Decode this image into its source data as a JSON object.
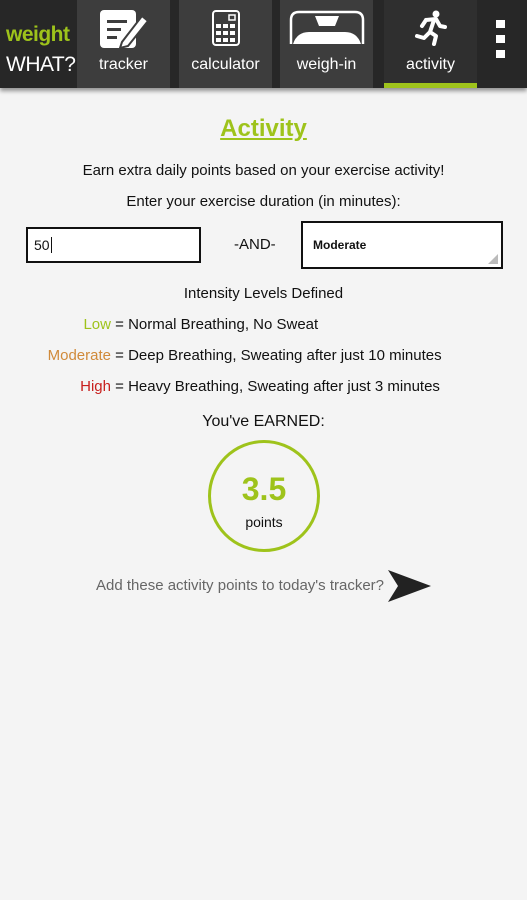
{
  "app": {
    "logo_top": "weight",
    "logo_bottom": "WHAT?"
  },
  "tabs": [
    {
      "label": "tracker",
      "icon": "tracker-icon"
    },
    {
      "label": "calculator",
      "icon": "calculator-icon"
    },
    {
      "label": "weigh-in",
      "icon": "scale-icon"
    },
    {
      "label": "activity",
      "icon": "running-icon",
      "active": true
    }
  ],
  "page": {
    "title": "Activity",
    "subtitle": "Earn extra daily points based on your exercise activity!",
    "prompt": "Enter your exercise duration (in minutes):",
    "duration_value": "50",
    "and_label": "-AND-",
    "intensity_value": "Moderate",
    "levels_title": "Intensity Levels Defined",
    "levels": [
      {
        "name": "Low",
        "desc": "= Normal Breathing, No Sweat",
        "color": "#9ec31b"
      },
      {
        "name": "Moderate",
        "desc": "= Deep Breathing, Sweating after just 10 minutes",
        "color": "#d08a3a"
      },
      {
        "name": "High",
        "desc": "= Heavy Breathing, Sweating after just 3 minutes",
        "color": "#c8201e"
      }
    ],
    "earned_label": "You've EARNED:",
    "points": "3.5",
    "points_unit": "points",
    "add_prompt": "Add these activity points to today's tracker?"
  },
  "colors": {
    "accent": "#9ec31b",
    "topbar": "#272727"
  }
}
